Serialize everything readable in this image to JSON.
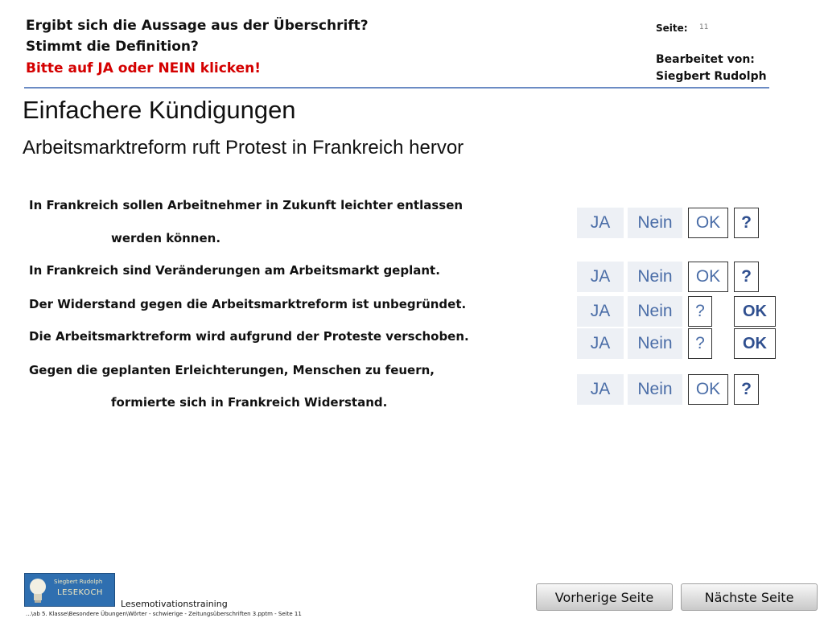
{
  "header": {
    "question1": "Ergibt sich die Aussage aus der Überschrift?",
    "question2": "Stimmt die Definition?",
    "instruction": "Bitte auf JA oder NEIN klicken!",
    "page_label": "Seite:",
    "page_number": "11",
    "edited_by_label": "Bearbeitet von:",
    "editor_name": "Siegbert Rudolph"
  },
  "title": "Einfachere Kündigungen",
  "subtitle": "Arbeitsmarktreform ruft Protest in Frankreich hervor",
  "statements": {
    "s1_line1": "In Frankreich sollen Arbeitnehmer in Zukunft leichter entlassen",
    "s1_line2": "werden können.",
    "s2": "In Frankreich sind Veränderungen am Arbeitsmarkt geplant.",
    "s3": "Der Widerstand gegen die Arbeitsmarktreform ist unbegründet.",
    "s4": "Die Arbeitsmarktreform wird aufgrund der Proteste verschoben.",
    "s5_line1": "Gegen die geplanten Erleichterungen, Menschen zu feuern,",
    "s5_line2": "formierte sich in Frankreich Widerstand."
  },
  "answers": {
    "yes": "JA",
    "no": "Nein",
    "ok": "OK",
    "question": "?"
  },
  "footer": {
    "logo_name": "Siegbert Rudolph",
    "logo_brand": "LESEKOCH",
    "title": "Lesemotivationstraining",
    "path": "...\\ab 5. Klasse\\Besondere Übungen\\Wörter - schwierige - Zeitungsüberschriften 3.pptm - Seite 11"
  },
  "nav": {
    "prev": "Vorherige Seite",
    "next": "Nächste Seite"
  },
  "colors": {
    "accent_blue": "#4a6da7",
    "instruction_red": "#d40000",
    "rule_blue": "#6b8bc4"
  }
}
